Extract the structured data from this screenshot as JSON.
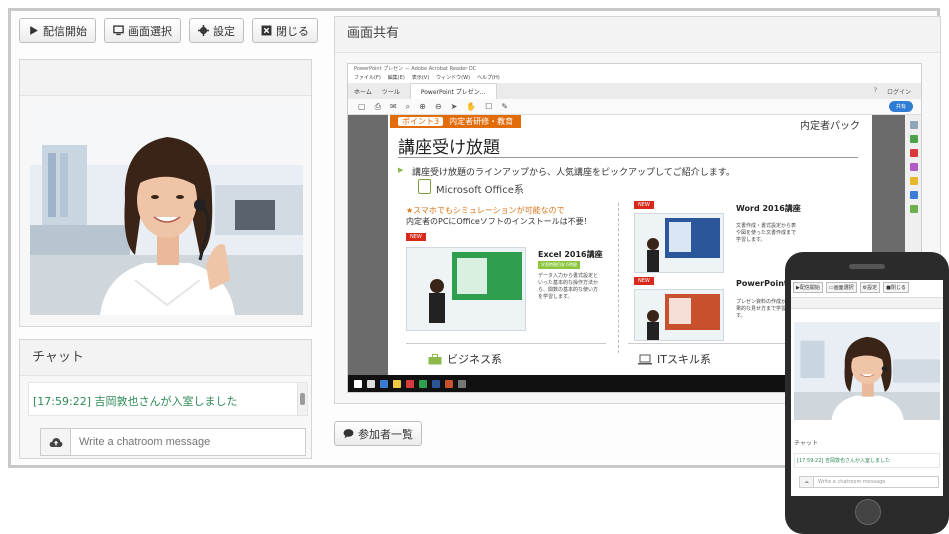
{
  "toolbar": {
    "start_broadcast": "配信開始",
    "select_screen": "画面選択",
    "settings": "設定",
    "close": "閉じる"
  },
  "chat": {
    "title": "チャット",
    "message": "[17:59:22] 吉岡敦也さんが入室しました",
    "input_placeholder": "Write a chatroom message"
  },
  "share": {
    "title": "画面共有",
    "participants_button": "参加者一覧"
  },
  "shared_app": {
    "menu": [
      "ファイル(F)",
      "編集(E)",
      "表示(V)",
      "ウィンドウ(W)",
      "ヘルプ(H)"
    ],
    "tabs": [
      "ホーム",
      "ツール",
      "PowerPoint プレゼン..."
    ],
    "login": "ログイン",
    "share_label": "共有"
  },
  "slide": {
    "point_badge": "ポイント3",
    "badge_title": "内定者研修・教育",
    "brand": "内定者パック",
    "title": "講座受け放題",
    "description": "講座受け放題のラインアップから、人気講座をピックアップしてご紹介します。",
    "office_category": "Microsoft Office系",
    "mobile_note": "★スマホでもシミュレーションが可能なので",
    "mobile_note2": "内定者のPCにOfficeソフトのインストールは不要！",
    "course1": "Excel 2016講座",
    "course2": "Word 2016講座",
    "course3": "PowerPoint",
    "new_tag": "NEW",
    "cat_business": "ビジネス系",
    "cat_it": "ITスキル系"
  },
  "phone": {
    "buttons": [
      "配信開始",
      "画面選択",
      "設定",
      "閉じる"
    ],
    "chat_title": "チャット",
    "chat_message": "[17:59:22] 吉岡敦也さんが入室しました",
    "input_placeholder": "Write a chatroom message"
  }
}
